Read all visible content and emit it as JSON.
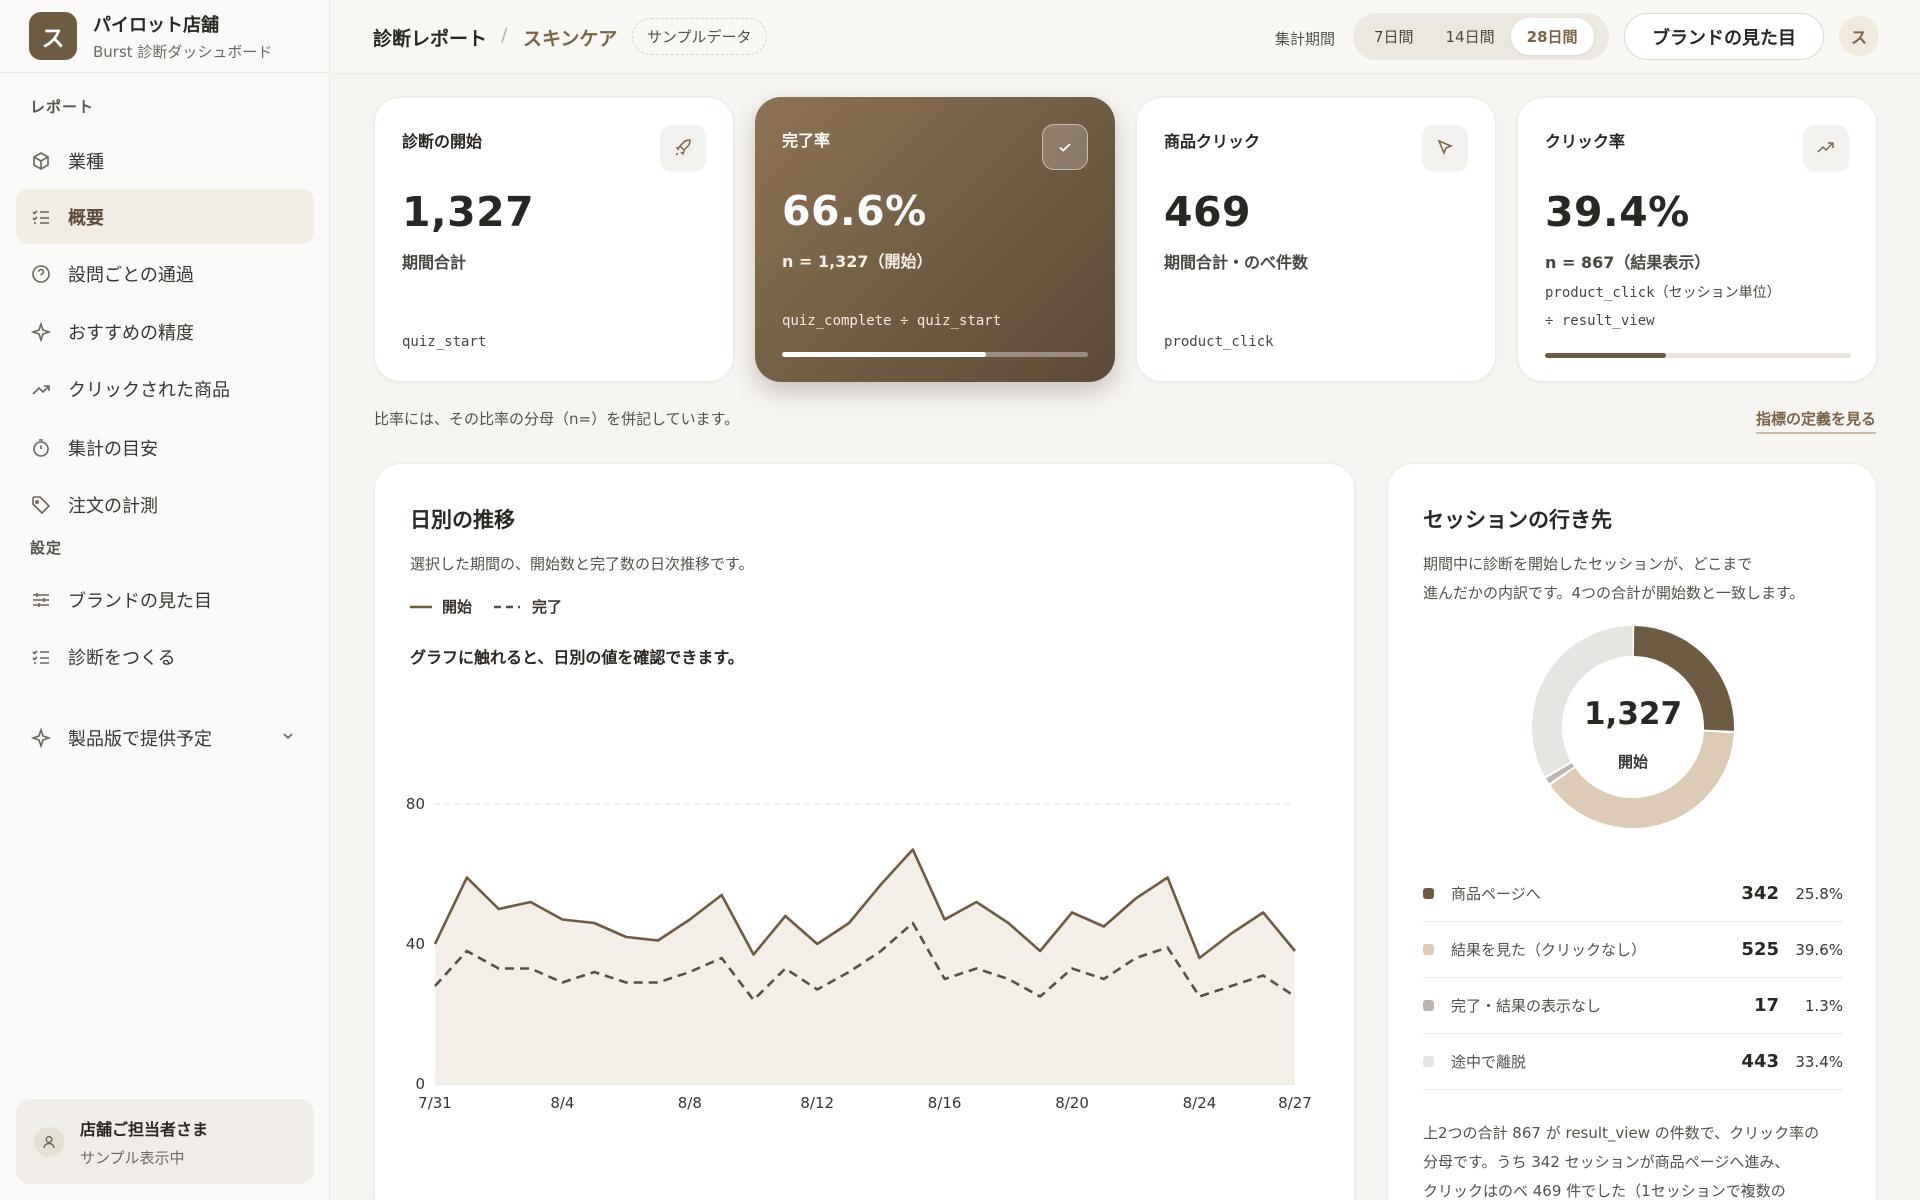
{
  "brand": {
    "logo_char": "ス",
    "name": "パイロット店舗",
    "subtitle": "Burst 診断ダッシュボード"
  },
  "sidebar": {
    "section_reports": "レポート",
    "items": [
      {
        "label": "業種",
        "icon": "cube-icon"
      },
      {
        "label": "概要",
        "icon": "list-check-icon",
        "active": true
      },
      {
        "label": "設問ごとの通過",
        "icon": "question-circle-icon"
      },
      {
        "label": "おすすめの精度",
        "icon": "sparkle-icon"
      },
      {
        "label": "クリックされた商品",
        "icon": "trend-up-icon"
      },
      {
        "label": "集計の目安",
        "icon": "timer-icon"
      },
      {
        "label": "注文の計測",
        "icon": "tag-icon"
      }
    ],
    "section_settings": "設定",
    "settings_items": [
      {
        "label": "ブランドの見た目",
        "icon": "sliders-icon"
      },
      {
        "label": "診断をつくる",
        "icon": "list-check-icon"
      }
    ],
    "upcoming": {
      "label": "製品版で提供予定",
      "icon": "sparkle-icon"
    },
    "user": {
      "name": "店舗ご担当者さま",
      "status": "サンプル表示中"
    }
  },
  "header": {
    "title": "診断レポート",
    "separator": "/",
    "category": "スキンケア",
    "sample_badge": "サンプルデータ",
    "period_label": "集計期間",
    "periods": [
      "7日間",
      "14日間",
      "28日間"
    ],
    "active_period": "28日間",
    "brand_button": "ブランドの見た目",
    "avatar_char": "ス"
  },
  "kpis": [
    {
      "title": "診断の開始",
      "value": "1,327",
      "sub": "期間合計",
      "code": "quiz_start",
      "icon": "rocket-icon"
    },
    {
      "title": "完了率",
      "value": "66.6%",
      "sub": "n = 1,327（開始）",
      "code": "quiz_complete ÷ quiz_start",
      "icon": "check-icon",
      "progress": 0.666
    },
    {
      "title": "商品クリック",
      "value": "469",
      "sub": "期間合計・のべ件数",
      "code": "product_click",
      "icon": "cursor-icon"
    },
    {
      "title": "クリック率",
      "value": "39.4%",
      "sub": "n = 867（結果表示）",
      "code": "product_click（セッション単位）",
      "code2": "÷ result_view",
      "icon": "trend-up-icon",
      "progress": 0.394
    }
  ],
  "note": "比率には、その比率の分母（n=）を併記しています。",
  "definitions_link": "指標の定義を見る",
  "daily": {
    "title": "日別の推移",
    "desc": "選択した期間の、開始数と完了数の日次推移です。",
    "legend_start": "開始",
    "legend_complete": "完了",
    "hint": "グラフに触れると、日別の値を確認できます。"
  },
  "chart_data": {
    "type": "line",
    "x": [
      "7/31",
      "8/1",
      "8/2",
      "8/3",
      "8/4",
      "8/5",
      "8/6",
      "8/7",
      "8/8",
      "8/9",
      "8/10",
      "8/11",
      "8/12",
      "8/13",
      "8/14",
      "8/15",
      "8/16",
      "8/17",
      "8/18",
      "8/19",
      "8/20",
      "8/21",
      "8/22",
      "8/23",
      "8/24",
      "8/25",
      "8/26",
      "8/27"
    ],
    "x_ticks": [
      "7/31",
      "8/4",
      "8/8",
      "8/12",
      "8/16",
      "8/20",
      "8/24",
      "8/27"
    ],
    "series": [
      {
        "name": "開始",
        "values": [
          40,
          59,
          50,
          52,
          47,
          46,
          42,
          41,
          47,
          54,
          37,
          48,
          40,
          46,
          57,
          67,
          47,
          52,
          46,
          38,
          49,
          45,
          53,
          59,
          36,
          43,
          49,
          38
        ],
        "color": "#6e5b43",
        "style": "solid"
      },
      {
        "name": "完了",
        "values": [
          28,
          38,
          33,
          33,
          29,
          32,
          29,
          29,
          32,
          36,
          24,
          33,
          27,
          32,
          38,
          46,
          30,
          33,
          30,
          25,
          33,
          30,
          36,
          39,
          25,
          28,
          31,
          25
        ],
        "color": "#55504a",
        "style": "dashed"
      }
    ],
    "ylim": [
      0,
      80
    ],
    "y_ticks": [
      0,
      40,
      80
    ],
    "grid": true
  },
  "sessions": {
    "title": "セッションの行き先",
    "desc": [
      "期間中に診断を開始したセッションが、どこまで",
      "進んだかの内訳です。4つの合計が開始数と一致します。"
    ],
    "center_value": "1,327",
    "center_label": "開始",
    "rows": [
      {
        "label": "商品ページへ",
        "value": "342",
        "pct": "25.8%",
        "fraction": 0.258,
        "color": "#6e5b43"
      },
      {
        "label": "結果を見た（クリックなし）",
        "value": "525",
        "pct": "39.6%",
        "fraction": 0.396,
        "color": "#dccbb5"
      },
      {
        "label": "完了・結果の表示なし",
        "value": "17",
        "pct": "1.3%",
        "fraction": 0.013,
        "color": "#b9b6b2"
      },
      {
        "label": "途中で離脱",
        "value": "443",
        "pct": "33.4%",
        "fraction": 0.334,
        "color": "#e6e4e1"
      }
    ],
    "footer": [
      "上2つの合計 867 が result_view の件数で、クリック率の",
      "分母です。うち 342 セッションが商品ページへ進み、",
      "クリックはのべ 469 件でした（1セッションで複数の"
    ]
  }
}
